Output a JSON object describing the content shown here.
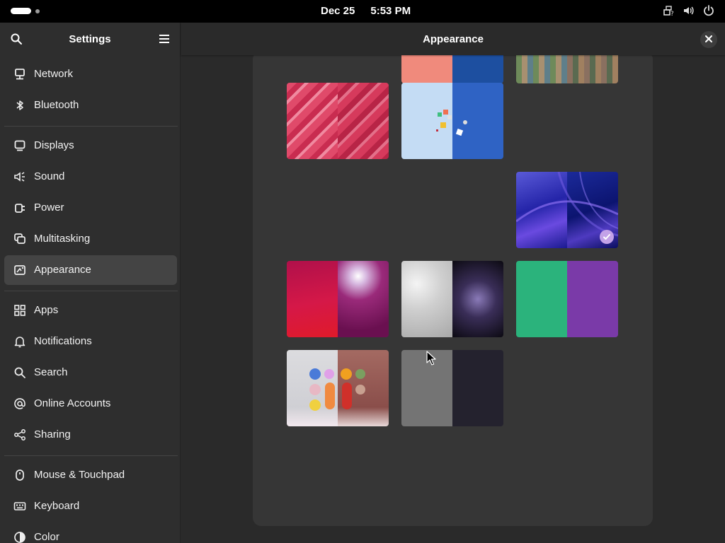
{
  "topbar": {
    "date": "Dec 25",
    "time": "5:53 PM",
    "icons": [
      "network-question-icon",
      "volume-icon",
      "power-icon"
    ]
  },
  "sidebar": {
    "title": "Settings",
    "items": [
      {
        "label": "Network",
        "icon": "network-icon"
      },
      {
        "label": "Bluetooth",
        "icon": "bluetooth-icon"
      },
      {
        "label": "Displays",
        "icon": "display-icon"
      },
      {
        "label": "Sound",
        "icon": "sound-icon"
      },
      {
        "label": "Power",
        "icon": "power-plug-icon"
      },
      {
        "label": "Multitasking",
        "icon": "multitasking-icon"
      },
      {
        "label": "Appearance",
        "icon": "appearance-icon",
        "active": true
      },
      {
        "label": "Apps",
        "icon": "apps-icon"
      },
      {
        "label": "Notifications",
        "icon": "bell-icon"
      },
      {
        "label": "Search",
        "icon": "search-icon"
      },
      {
        "label": "Online Accounts",
        "icon": "at-icon"
      },
      {
        "label": "Sharing",
        "icon": "share-icon"
      },
      {
        "label": "Mouse & Touchpad",
        "icon": "mouse-icon"
      },
      {
        "label": "Keyboard",
        "icon": "keyboard-icon"
      },
      {
        "label": "Color",
        "icon": "color-icon"
      }
    ]
  },
  "content": {
    "title": "Appearance"
  },
  "wallpapers": [
    {
      "name": "wallpaper-partial-1",
      "light": "#f08a7c",
      "dark": "#1d4fa0"
    },
    {
      "name": "wallpaper-partial-2",
      "light": "#8a8f6a",
      "dark": "#7c6a56"
    },
    {
      "name": "wallpaper-pills-pink",
      "light": "#d8365a",
      "dark": "#c83050"
    },
    {
      "name": "wallpaper-blocks-blue",
      "light": "#bcd6f2",
      "dark": "#2f63c4"
    },
    {
      "name": "wallpaper-waves-blue",
      "light": "#2c2fb0",
      "dark": "#111a7a",
      "selected": true
    },
    {
      "name": "wallpaper-red-purple",
      "light": "#c8124a",
      "dark": "#7a1254"
    },
    {
      "name": "wallpaper-glass",
      "light": "#d9d9d9",
      "dark": "#1c1626"
    },
    {
      "name": "wallpaper-green-purple",
      "light": "#2bb37c",
      "dark": "#7a3aa8"
    },
    {
      "name": "wallpaper-fidgets",
      "light": "#d5d5d8",
      "dark": "#a86a62"
    },
    {
      "name": "wallpaper-gray-navy",
      "light": "#747474",
      "dark": "#24222e"
    }
  ]
}
